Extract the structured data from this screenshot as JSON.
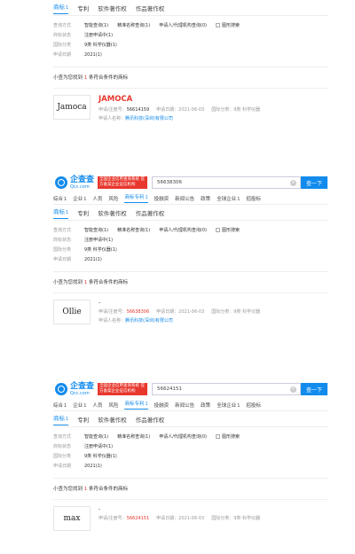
{
  "header": {
    "logo_main": "企查查",
    "logo_sub": "Qcc.com",
    "promo": "全国企业信用查询系统 官方备案企业征信机构",
    "search_btn": "查一下"
  },
  "nav": [
    "综合",
    "企业",
    "人员",
    "风险",
    "商标专利",
    "投融资",
    "新闻公告",
    "政策",
    "全球企业",
    "招投标"
  ],
  "nav_counts": [
    "1",
    "1",
    "",
    "",
    "1",
    "",
    "",
    "",
    "1",
    ""
  ],
  "tabs": {
    "trademark": "商标",
    "trademark_count": "1",
    "patent": "专利",
    "copyright": "软件著作权",
    "works": "作品著作权"
  },
  "filters": {
    "method_label": "查询方式",
    "method_opts": [
      "智能查询(1)",
      "精准名称查询(1)",
      "申请人/代理机构查询(0)"
    ],
    "figure_search": "图形搜索",
    "status_label": "商标状态",
    "status_val": "注册申请中(1)",
    "class_label": "国际分类",
    "class_val": "9类 科学仪器(1)",
    "date_label": "申请日期",
    "date_val": "2021(1)"
  },
  "result_text": {
    "pre": "小查为您找到",
    "count": "1",
    "post": "条符合条件的商标"
  },
  "labels": {
    "reg_no": "申请/注册号：",
    "apply_date": "申请日期：",
    "intl_class": "国际分类：",
    "applicant": "申请人名称："
  },
  "panels": [
    {
      "query": "",
      "thumb": "Jamoca",
      "name": "JAMOCA",
      "reg_no": "56614159",
      "date": "2021-06-03",
      "class": "9类 科学仪器",
      "applicant": "腾讯科技(深圳)有限公司"
    },
    {
      "query": "56638306",
      "thumb": "Ollie",
      "name": "-",
      "reg_no": "56638306",
      "date": "2021-06-03",
      "class": "9类 科学仪器",
      "applicant": "腾讯科技(深圳)有限公司"
    },
    {
      "query": "56624151",
      "thumb": "max",
      "name": "-",
      "reg_no": "56624151",
      "date": "2021-06-03",
      "class": "9类 科学仪器",
      "applicant": ""
    }
  ]
}
